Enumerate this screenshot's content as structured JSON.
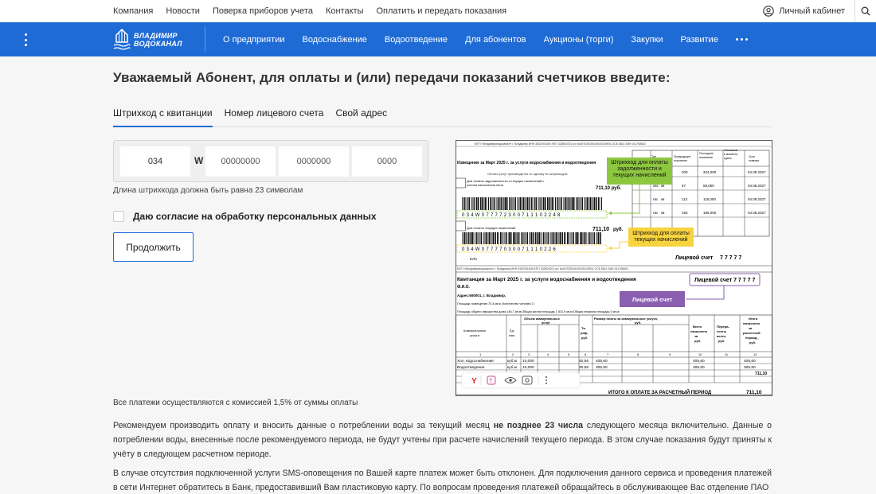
{
  "topbar": {
    "links": [
      "Компания",
      "Новости",
      "Поверка приборов учета",
      "Контакты",
      "Оплатить и передать показания"
    ],
    "cabinet_label": "Личный кабинет"
  },
  "logo": {
    "line1": "ВЛАДИМИР",
    "line2": "ВОДОКАНАЛ"
  },
  "nav": {
    "items": [
      "О предприятии",
      "Водоснабжение",
      "Водоотведение",
      "Для абонентов",
      "Аукционы (торги)",
      "Закупки",
      "Развитие"
    ]
  },
  "page": {
    "title": "Уважаемый Абонент, для оплаты и (или) передачи показаний счетчиков введите:"
  },
  "tabs": [
    "Штрихкод с квитанции",
    "Номер лицевого счета",
    "Свой адрес"
  ],
  "barcode": {
    "field1_value": "034",
    "separator": "W",
    "field2_placeholder": "00000000",
    "field3_placeholder": "0000000",
    "field4_placeholder": "0000",
    "hint": "Длина штрихкода должна быть равна 23 символам"
  },
  "consent": {
    "label": "Даю согласие на обработку персональных данных"
  },
  "submit": {
    "label": "Продолжить"
  },
  "receipt": {
    "notice_title": "Извещение за Март 2025 г.  за услуги водоснабжения и водоотведения",
    "callout_debt": "Штрихкод для оплаты задолженности и текущих начислений",
    "callout_current": "Штрихкод для оплаты текущих начислений",
    "callout_account": "Лицевой счет",
    "barcode_digits_1": "0 3 4 W 0 7 7 7 7 2 3 0 0 7 1 1 1 0 2 2 4 8",
    "barcode_digits_2": "0 3 4 W 0 7 7 7 7 0 3 0 0 7 1 1 1 0 2 2 6",
    "amount": "711,10 руб.",
    "account_label": "Лицевой счет",
    "account_number": "7 7 7 7 7",
    "receipt_title": "Квитанция за Март 2025 г. за услуги водоснабжения и водоотведения",
    "fio": "Ф.И.О.",
    "address": "Адрес:600001, г. Владимир,",
    "els": "ЕЛС",
    "total_label": "ИТОГО К ОПЛАТЕ ЗА РАСЧЕТНЫЙ ПЕРИОД",
    "total_value": "711,10",
    "meter_rows": [
      [
        "хвс",
        "кв",
        "200",
        "204,000",
        "04.08.2027"
      ],
      [
        "хвс",
        "кв",
        "57",
        "59,000",
        "04.08.2027"
      ],
      [
        "гвс",
        "кв",
        "113",
        "115,000",
        "04.08.2027"
      ],
      [
        "гвс",
        "кв",
        "193",
        "196,000",
        "04.08.2027"
      ]
    ],
    "service_rows": [
      [
        "Хол. водоснабжение",
        "куб.м",
        "10,000",
        "40,56",
        "405,60",
        "405,60",
        "405,60"
      ],
      [
        "Водоотведение",
        "куб.м",
        "10,000",
        "30,55",
        "305,50",
        "305,50",
        "305,50"
      ]
    ],
    "subtotal": "711,10"
  },
  "notes": {
    "commission": "Все платежи осуществляются с комиссией 1,5% от суммы оплаты",
    "para1_a": "Рекомендуем производить оплату и вносить данные о потреблении воды за текущий месяц ",
    "para1_b": "не позднее 23 числа",
    "para1_c": " следующего месяца включительно. Данные о потреблении воды, внесенные после рекомендуемого периода, не будут учтены при расчете начислений текущего периода. В этом случае показания будут приняты к учёту в следующем расчетном периоде.",
    "para2": "В случае отсутствия подключенной услуги SMS-оповещения по Вашей карте платеж может быть отклонен. Для подключения данного сервиса и проведения платежей в сети Интернет обратитесь в Банк, предоставивший Вам пластиковую карту. По вопросам проведения платежей обращайтесь в обслуживающее Вас отделение ПАО"
  },
  "colors": {
    "brand": "#1e6bd6",
    "callout_green": "#8dc63f",
    "callout_yellow": "#f7d33f",
    "callout_purple": "#8a5fb0"
  }
}
